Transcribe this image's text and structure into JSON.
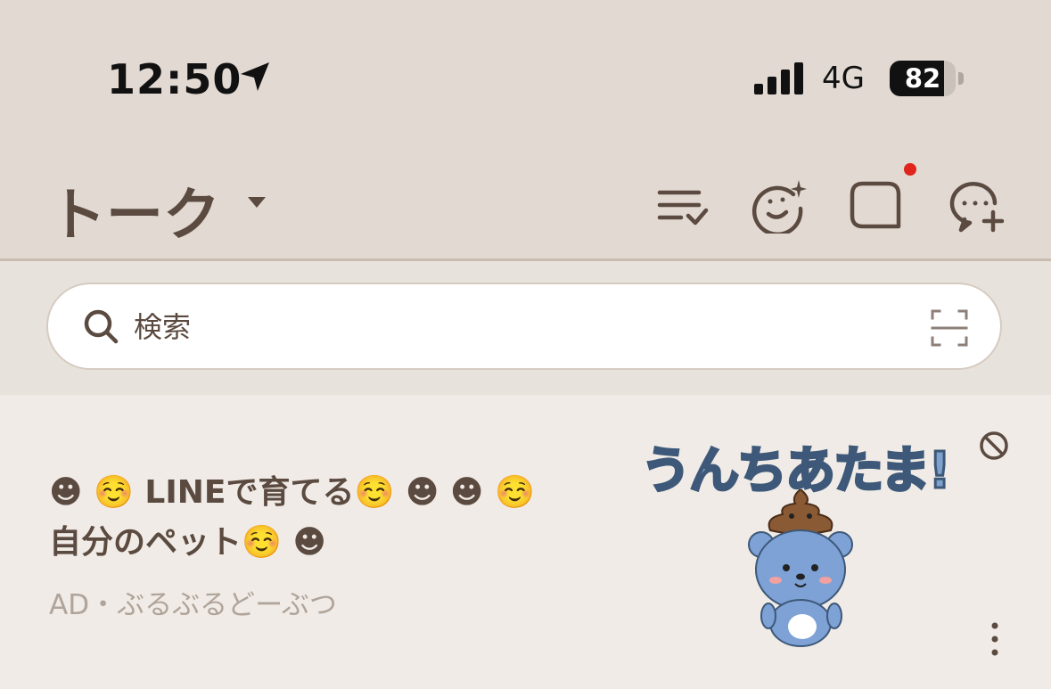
{
  "status_bar": {
    "time": "12:50",
    "network": "4G",
    "battery_percent": "82",
    "battery_level": 0.82
  },
  "header": {
    "title": "トーク",
    "icons": [
      "edit-list-icon",
      "face-sparkle-icon",
      "chat-bubble-icon",
      "add-chat-icon"
    ]
  },
  "search": {
    "placeholder": "検索"
  },
  "ad": {
    "title_line1": "☻ ☺️ LINEで育てる☺️ ☻  ☻ ☺️",
    "title_line2": "自分のペット☺️ ☻",
    "subtitle": "AD・ぶるぶるどーぶつ",
    "image_text": "うんちあたま!"
  },
  "colors": {
    "header_bg": "#e1d9d2",
    "text_brown": "#5b4a40",
    "notification_dot": "#e0251c"
  }
}
